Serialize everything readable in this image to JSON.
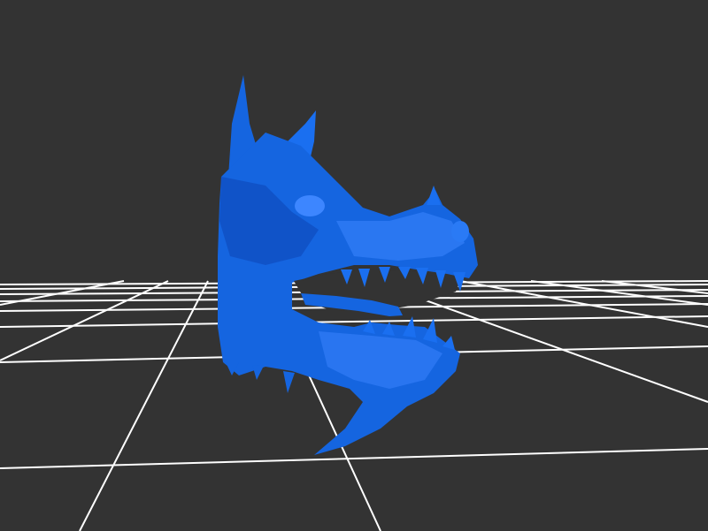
{
  "viewer": {
    "background_color": "#333333",
    "grid_color": "#ffffff",
    "model_color": "#1565e0",
    "model_shade_dark": "#0d47b8",
    "model_shade_light": "#3d86ff",
    "model_name": "dragon-head-mesh"
  }
}
